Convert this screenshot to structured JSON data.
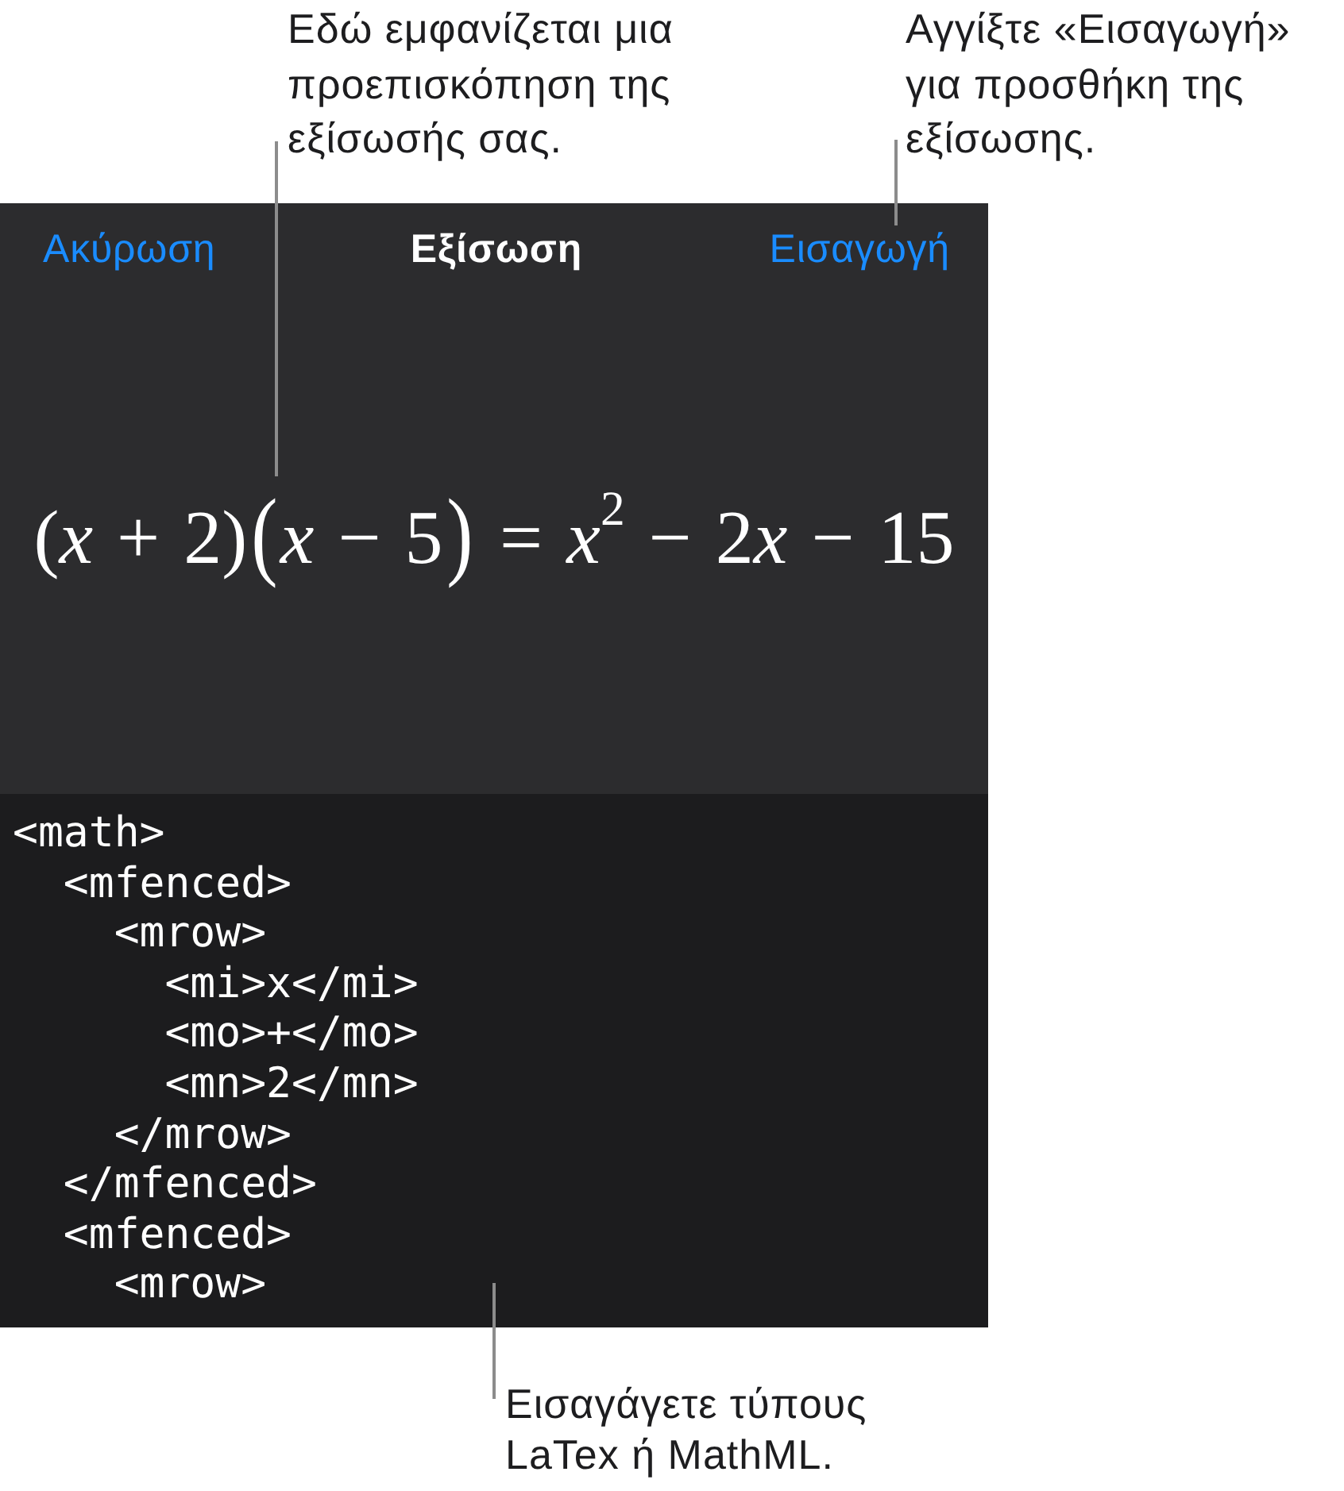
{
  "top_callouts": [
    {
      "text": "Εδώ εμφανίζεται μια προεπισκόπηση της εξίσωσής σας."
    },
    {
      "text": "Αγγίξτε «Εισαγωγή» για προσθήκη της εξίσωσης."
    }
  ],
  "sheet": {
    "cancel_label": "Ακύρωση",
    "title": "Εξίσωση",
    "insert_label": "Εισαγωγή",
    "preview_equation": [
      {
        "kind": "paren",
        "text": "("
      },
      {
        "kind": "identifier",
        "text": "x"
      },
      {
        "kind": "operator",
        "text": " + "
      },
      {
        "kind": "number",
        "text": "2"
      },
      {
        "kind": "paren",
        "text": ")"
      },
      {
        "kind": "large_paren",
        "text": "("
      },
      {
        "kind": "identifier",
        "text": "x"
      },
      {
        "kind": "operator",
        "text": " − "
      },
      {
        "kind": "number",
        "text": "5"
      },
      {
        "kind": "large_paren",
        "text": ")"
      },
      {
        "kind": "operator",
        "text": " = "
      },
      {
        "kind": "identifier",
        "text": "x"
      },
      {
        "kind": "superscript",
        "text": "2"
      },
      {
        "kind": "operator",
        "text": " − "
      },
      {
        "kind": "number",
        "text": "2"
      },
      {
        "kind": "identifier",
        "text": "x"
      },
      {
        "kind": "operator",
        "text": " − "
      },
      {
        "kind": "number",
        "text": "15"
      }
    ],
    "code_field": {
      "value": "<math>\n  <mfenced>\n    <mrow>\n      <mi>x</mi>\n      <mo>+</mo>\n      <mn>2</mn>\n    </mrow>\n  </mfenced>\n  <mfenced>\n    <mrow>"
    }
  },
  "bottom_callout": {
    "text": "Εισαγάγετε τύπους LaTex ή MathML."
  }
}
